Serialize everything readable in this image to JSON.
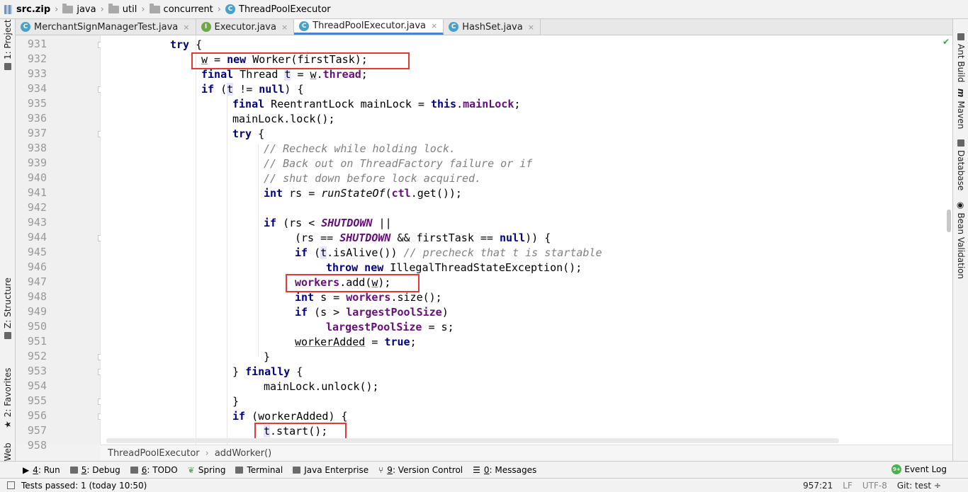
{
  "navbar": {
    "items": [
      {
        "label": "src.zip",
        "icon": "zip-icon"
      },
      {
        "label": "java",
        "icon": "folder-icon"
      },
      {
        "label": "util",
        "icon": "folder-icon"
      },
      {
        "label": "concurrent",
        "icon": "folder-icon"
      },
      {
        "label": "ThreadPoolExecutor",
        "icon": "class-icon"
      }
    ]
  },
  "tabs": [
    {
      "label": "MerchantSignManagerTest.java",
      "icon": "class-icon",
      "close": "×"
    },
    {
      "label": "Executor.java",
      "icon": "interface-icon",
      "close": "×"
    },
    {
      "label": "ThreadPoolExecutor.java",
      "icon": "class-icon",
      "close": "×",
      "active": true
    },
    {
      "label": "HashSet.java",
      "icon": "class-icon",
      "close": "×"
    }
  ],
  "left_tools": {
    "project": "1: Project",
    "structure": "Z: Structure",
    "favorites": "2: Favorites",
    "web": "Web"
  },
  "right_tools": {
    "ant": "Ant Build",
    "maven": "Maven",
    "database": "Database",
    "bean": "Bean Validation"
  },
  "editor": {
    "line_numbers": [
      "931",
      "932",
      "933",
      "934",
      "935",
      "936",
      "937",
      "938",
      "939",
      "940",
      "941",
      "942",
      "943",
      "944",
      "945",
      "946",
      "947",
      "948",
      "949",
      "950",
      "951",
      "952",
      "953",
      "954",
      "955",
      "956",
      "957",
      "958"
    ],
    "current_line": "957"
  },
  "breadcrumb": {
    "class_name": "ThreadPoolExecutor",
    "separator": "›",
    "method": "addWorker()"
  },
  "toolwindows": [
    {
      "num": "4",
      "label": ": Run",
      "icon": "run-icon"
    },
    {
      "num": "5",
      "label": ": Debug",
      "icon": "debug-icon"
    },
    {
      "num": "6",
      "label": ": TODO",
      "icon": "todo-icon"
    },
    {
      "num": "",
      "label": "Spring",
      "icon": "spring-icon"
    },
    {
      "num": "",
      "label": "Terminal",
      "icon": "terminal-icon"
    },
    {
      "num": "",
      "label": "Java Enterprise",
      "icon": "java-enterprise-icon"
    },
    {
      "num": "9",
      "label": ": Version Control",
      "icon": "version-control-icon"
    },
    {
      "num": "0",
      "label": ": Messages",
      "icon": "messages-icon"
    }
  ],
  "event_log": {
    "badge": "9+",
    "label": "Event Log"
  },
  "status": {
    "message": "Tests passed: 1 (today 10:50)",
    "position": "957:21",
    "line_sep": "LF",
    "encoding": "UTF-8",
    "git": "Git: test",
    "git_arrow": "÷"
  },
  "colors": {
    "keyword": "#000080",
    "field": "#660e7a",
    "comment": "#808080",
    "highlight_box": "#e53935",
    "active_tab": "#ffffff",
    "caret_line": "#fffbe6"
  }
}
